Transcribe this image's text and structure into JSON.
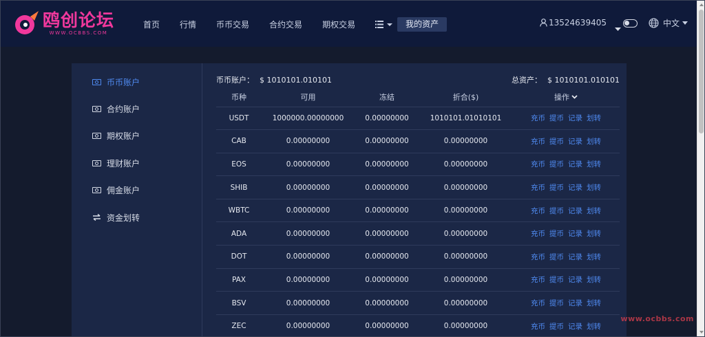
{
  "header": {
    "logo_title": "鸥创论坛",
    "logo_sub": "WWW.OCBBS.COM",
    "nav": [
      "首页",
      "行情",
      "币币交易",
      "合约交易",
      "期权交易"
    ],
    "nav_active": "我的资产",
    "user": "13524639405",
    "language": "中文"
  },
  "sidebar": {
    "items": [
      {
        "label": "币币账户",
        "icon": "wallet-icon",
        "active": true
      },
      {
        "label": "合约账户",
        "icon": "wallet-icon",
        "active": false
      },
      {
        "label": "期权账户",
        "icon": "wallet-icon",
        "active": false
      },
      {
        "label": "理财账户",
        "icon": "wallet-icon",
        "active": false
      },
      {
        "label": "佣金账户",
        "icon": "wallet-icon",
        "active": false
      },
      {
        "label": "资金划转",
        "icon": "transfer-icon",
        "active": false
      }
    ]
  },
  "summary": {
    "account_label": "币币账户：",
    "account_value": "$ 1010101.010101",
    "total_label": "总资产：",
    "total_value": "$ 1010101.010101"
  },
  "table": {
    "headers": [
      "币种",
      "可用",
      "冻结",
      "折合($)",
      "操作"
    ],
    "actions": [
      "充币",
      "提币",
      "记录",
      "划转"
    ],
    "rows": [
      [
        "USDT",
        "1000000.00000000",
        "0.00000000",
        "1010101.01010101"
      ],
      [
        "CAB",
        "0.00000000",
        "0.00000000",
        "0.00000000"
      ],
      [
        "EOS",
        "0.00000000",
        "0.00000000",
        "0.00000000"
      ],
      [
        "SHIB",
        "0.00000000",
        "0.00000000",
        "0.00000000"
      ],
      [
        "WBTC",
        "0.00000000",
        "0.00000000",
        "0.00000000"
      ],
      [
        "ADA",
        "0.00000000",
        "0.00000000",
        "0.00000000"
      ],
      [
        "DOT",
        "0.00000000",
        "0.00000000",
        "0.00000000"
      ],
      [
        "PAX",
        "0.00000000",
        "0.00000000",
        "0.00000000"
      ],
      [
        "BSV",
        "0.00000000",
        "0.00000000",
        "0.00000000"
      ],
      [
        "ZEC",
        "0.00000000",
        "0.00000000",
        "0.00000000"
      ]
    ]
  },
  "watermark": "www.ocbbs.com",
  "colors": {
    "header_bg": "#0f1a3a",
    "panel_bg": "#1b2746",
    "accent": "#4f8af0",
    "brand": "#f0389c"
  }
}
